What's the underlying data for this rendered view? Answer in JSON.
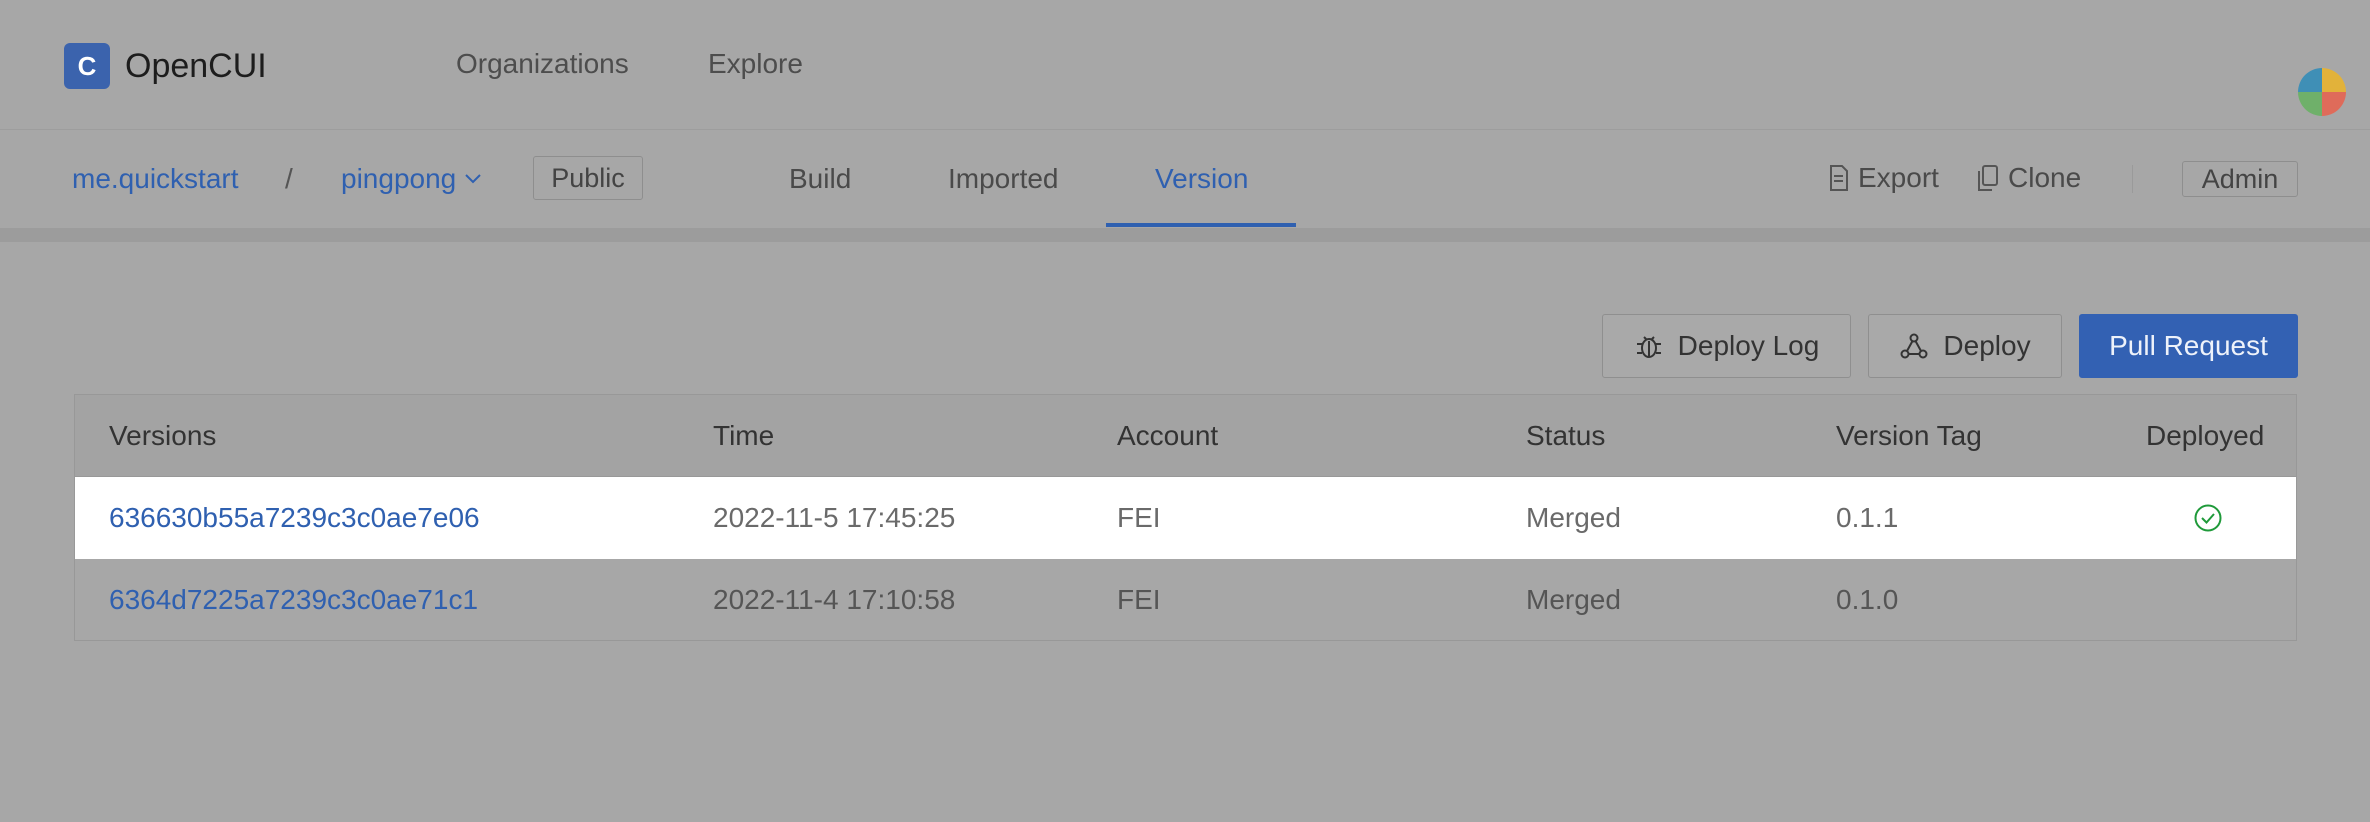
{
  "app": {
    "logo_glyph": "C",
    "name": "OpenCUI"
  },
  "topnav": {
    "organizations": "Organizations",
    "explore": "Explore"
  },
  "breadcrumb": {
    "org": "me.quickstart",
    "separator": "/",
    "project": "pingpong",
    "visibility": "Public"
  },
  "tabs": [
    "Build",
    "Imported",
    "Version"
  ],
  "active_tab": "Version",
  "actions": {
    "export": "Export",
    "clone": "Clone",
    "admin": "Admin"
  },
  "toolbar": {
    "deploy_log": "Deploy Log",
    "deploy": "Deploy",
    "pull_request": "Pull Request"
  },
  "table": {
    "columns": [
      "Versions",
      "Time",
      "Account",
      "Status",
      "Version Tag",
      "Deployed"
    ],
    "rows": [
      {
        "version": "636630b55a7239c3c0ae7e06",
        "time": "2022-11-5 17:45:25",
        "account": "FEI",
        "status": "Merged",
        "tag": "0.1.1",
        "deployed": true
      },
      {
        "version": "6364d7225a7239c3c0ae71c1",
        "time": "2022-11-4 17:10:58",
        "account": "FEI",
        "status": "Merged",
        "tag": "0.1.0",
        "deployed": false
      }
    ]
  },
  "colors": {
    "accent": "#2f60b0",
    "primary_button": "#3361b3",
    "deployed_check": "#1f9a3a",
    "overlay": "#a7a7a7"
  }
}
